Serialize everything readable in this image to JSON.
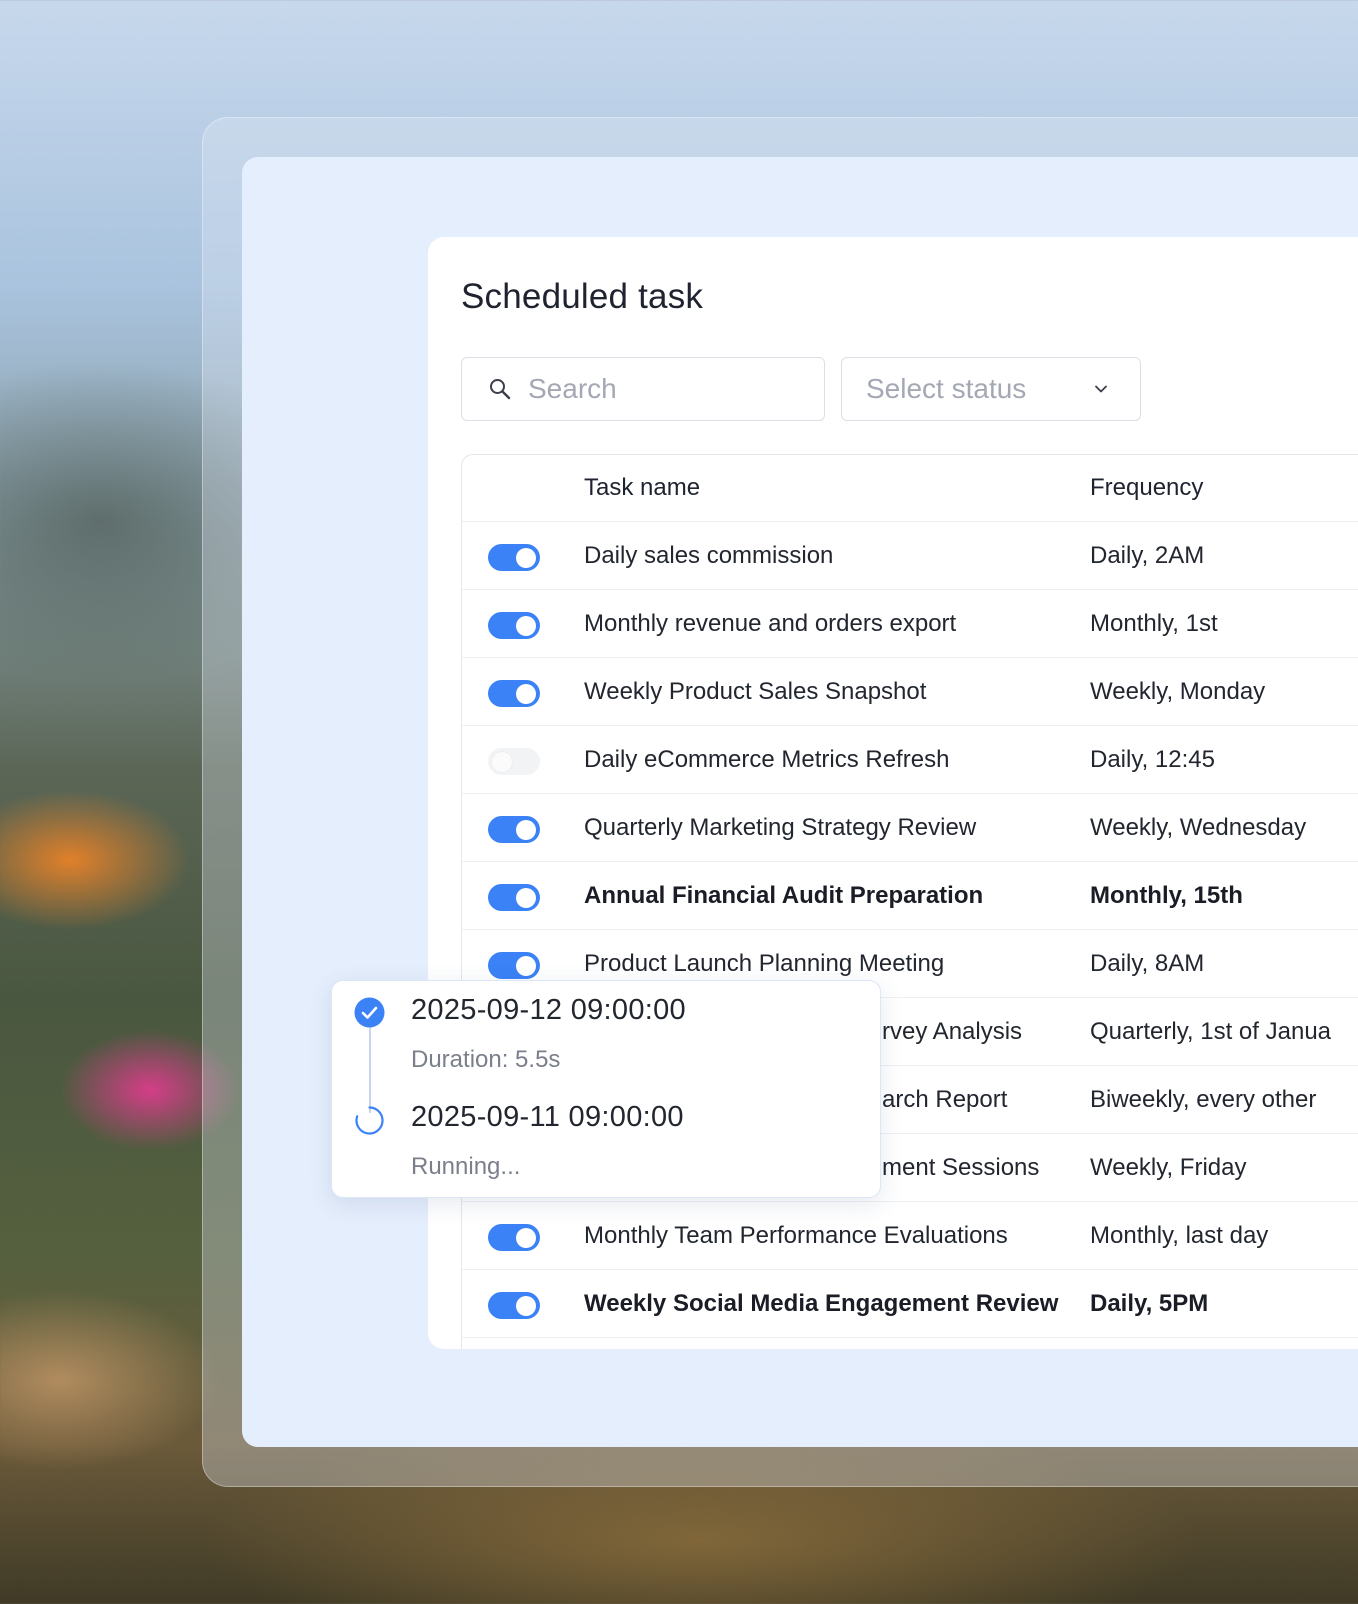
{
  "page": {
    "title": "Scheduled task"
  },
  "search": {
    "placeholder": "Search"
  },
  "status_filter": {
    "placeholder": "Select status"
  },
  "table": {
    "columns": [
      "Task name",
      "Frequency"
    ],
    "rows": [
      {
        "enabled": true,
        "name": "Daily sales commission",
        "frequency": "Daily, 2AM",
        "bold": false
      },
      {
        "enabled": true,
        "name": "Monthly revenue and orders export",
        "frequency": "Monthly, 1st",
        "bold": false
      },
      {
        "enabled": true,
        "name": "Weekly Product Sales Snapshot",
        "frequency": "Weekly, Monday",
        "bold": false
      },
      {
        "enabled": false,
        "name": "Daily eCommerce Metrics Refresh",
        "frequency": "Daily, 12:45",
        "bold": false
      },
      {
        "enabled": true,
        "name": "Quarterly Marketing Strategy Review",
        "frequency": "Weekly, Wednesday",
        "bold": false
      },
      {
        "enabled": true,
        "name": "Annual Financial Audit Preparation",
        "frequency": "Monthly, 15th",
        "bold": true
      },
      {
        "enabled": true,
        "name": "Product Launch Planning Meeting",
        "frequency": "Daily, 8AM",
        "bold": false
      },
      {
        "enabled": true,
        "name": "rvey Analysis",
        "frequency": "Quarterly, 1st of Janua",
        "bold": false
      },
      {
        "enabled": true,
        "name": "arch Report",
        "frequency": "Biweekly, every other",
        "bold": false
      },
      {
        "enabled": true,
        "name": "ment Sessions",
        "frequency": "Weekly, Friday",
        "bold": false
      },
      {
        "enabled": true,
        "name": "Monthly Team Performance Evaluations",
        "frequency": "Monthly, last day",
        "bold": false
      },
      {
        "enabled": true,
        "name": "Weekly Social Media Engagement Review",
        "frequency": "Daily, 5PM",
        "bold": true
      }
    ]
  },
  "run_history": {
    "entries": [
      {
        "time": "2025-09-12 09:00:00",
        "detail": "Duration: 5.5s",
        "status_icon": "check-circle-icon"
      },
      {
        "time": "2025-09-11 09:00:00",
        "detail": "Running...",
        "status_icon": "spinner-icon"
      }
    ]
  },
  "colors": {
    "accent": "#3b82f6",
    "panel_bg": "#e5eefc",
    "text": "#22262f",
    "muted": "#7a7f8a"
  }
}
